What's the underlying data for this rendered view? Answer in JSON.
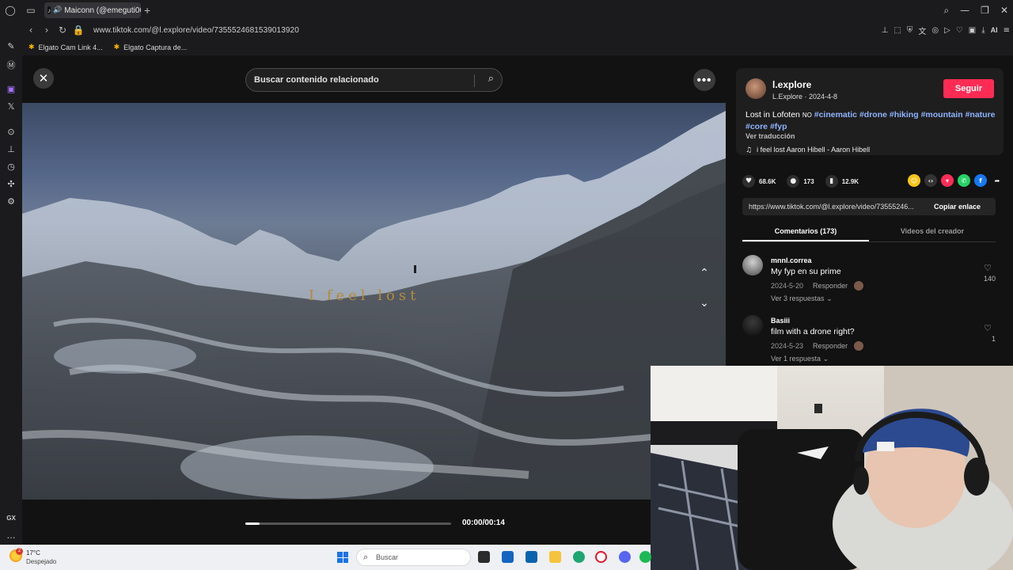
{
  "browser": {
    "tab_title": "Maiconn (@emeguti06",
    "url": "www.tiktok.com/@l.explore/video/7355524681539013920",
    "bookmarks": [
      "Elgato Cam Link 4...",
      "Elgato Captura de..."
    ],
    "ai_label": "AI",
    "sidebar_gx": "GX"
  },
  "player": {
    "search_placeholder": "Buscar contenido relacionado",
    "video_overlay_text": "I feel lost",
    "time": "00:00/00:14",
    "progress_fraction": 0.07
  },
  "panel": {
    "username": "l.explore",
    "subline": "L.Explore · 2024-4-8",
    "follow_label": "Seguir",
    "caption_text": "Lost in Lofoten",
    "caption_no": "NO",
    "hashtags": [
      "#cinematic",
      "#drone",
      "#hiking",
      "#mountain",
      "#nature",
      "#core",
      "#fyp"
    ],
    "translate_label": "Ver traducción",
    "music": "i feel lost Aaron Hibell - Aaron Hibell",
    "likes": "68.6K",
    "comments": "173",
    "saves": "12.9K",
    "link": "https://www.tiktok.com/@l.explore/video/73555246...",
    "copy_label": "Copiar enlace",
    "tab_comments": "Comentarios (173)",
    "tab_creator": "Videos del creador",
    "comment_list": [
      {
        "user": "mnnl.correa",
        "text": "My fyp en su prime",
        "date": "2024-5-20",
        "reply": "Responder",
        "more": "Ver 3 respuestas",
        "likes": "140"
      },
      {
        "user": "Basiii",
        "text": "film with a drone right?",
        "date": "2024-5-23",
        "reply": "Responder",
        "more": "Ver 1 respuesta",
        "likes": "1"
      }
    ]
  },
  "taskbar": {
    "temp": "17°C",
    "condition": "Despejado",
    "weather_badge": "2",
    "search": "Buscar"
  },
  "colors": {
    "follow": "#fe2c55",
    "hashtag": "#8fb4ff",
    "twitch": "#a970ff"
  }
}
